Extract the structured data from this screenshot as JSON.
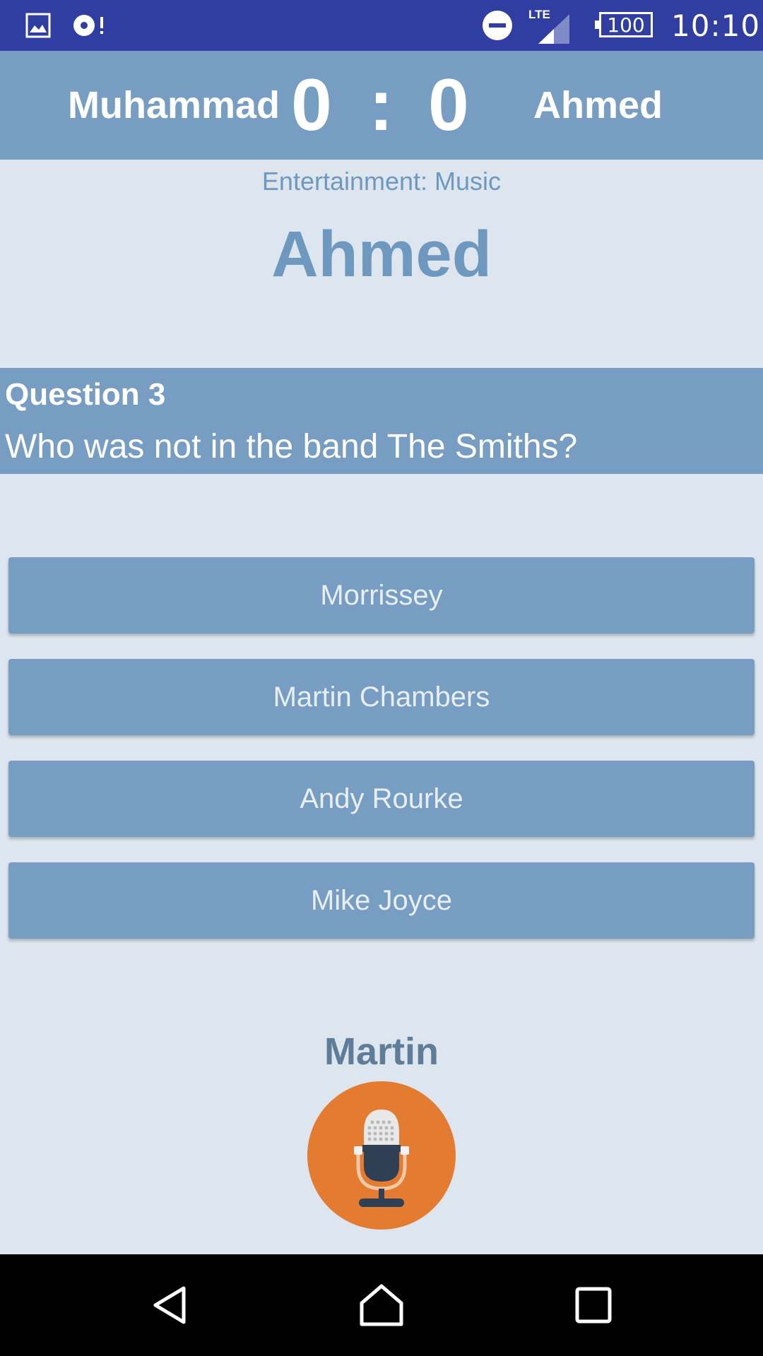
{
  "status_bar": {
    "time": "10:10",
    "battery": "100",
    "network": "LTE",
    "icons": [
      "gallery-icon",
      "sync-alert-icon",
      "do-not-disturb-icon",
      "signal-icon",
      "battery-icon"
    ]
  },
  "scoreboard": {
    "player1": "Muhammad",
    "score1": "0",
    "separator": ":",
    "score2": "0",
    "player2": "Ahmed"
  },
  "category": "Entertainment: Music",
  "current_player": "Ahmed",
  "question": {
    "number_label": "Question 3",
    "text": "Who was not in the band The Smiths?"
  },
  "answers": [
    {
      "label": "Morrissey"
    },
    {
      "label": "Martin Chambers"
    },
    {
      "label": "Andy Rourke"
    },
    {
      "label": "Mike Joyce"
    }
  ],
  "voice": {
    "recognized_text": "Martin",
    "icon": "microphone-icon"
  },
  "colors": {
    "status_bar": "#2f3ea0",
    "accent": "#779ec2",
    "background": "#dde6ef",
    "mic": "#e37b31"
  },
  "nav": {
    "icons": [
      "back-icon",
      "home-icon",
      "recents-icon"
    ]
  }
}
